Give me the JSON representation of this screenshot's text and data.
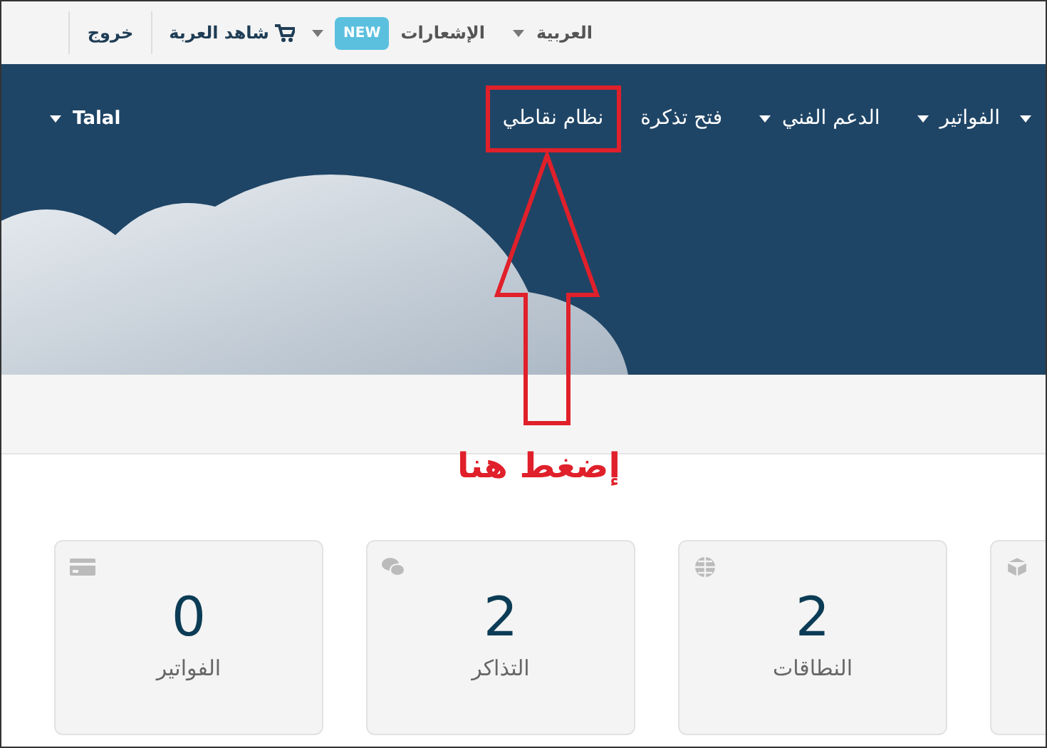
{
  "top_bar": {
    "items": [
      {
        "kind": "dropdown",
        "label": "العربية"
      },
      {
        "kind": "notifications",
        "label": "الإشعارات",
        "badge": "NEW"
      },
      {
        "kind": "cart",
        "label": "شاهد العربة"
      },
      {
        "kind": "link",
        "label": "خروج"
      }
    ]
  },
  "nav": {
    "items": [
      {
        "kind": "caret"
      },
      {
        "kind": "dropdown",
        "label": "الفواتير",
        "highlighted": false
      },
      {
        "kind": "dropdown",
        "label": "الدعم الفني",
        "highlighted": false
      },
      {
        "kind": "link",
        "label": "فتح تذكرة",
        "highlighted": false
      },
      {
        "kind": "link",
        "label": "نظام نقاطي",
        "highlighted": true
      }
    ],
    "user": "Talal"
  },
  "annotation": {
    "text": "إضغط هنا"
  },
  "cards": [
    {
      "kind": "partial"
    },
    {
      "kind": "stat",
      "value": "2",
      "label": "النطاقات"
    },
    {
      "kind": "stat",
      "value": "2",
      "label": "التذاكر"
    },
    {
      "kind": "stat",
      "value": "0",
      "label": "الفواتير"
    }
  ]
}
